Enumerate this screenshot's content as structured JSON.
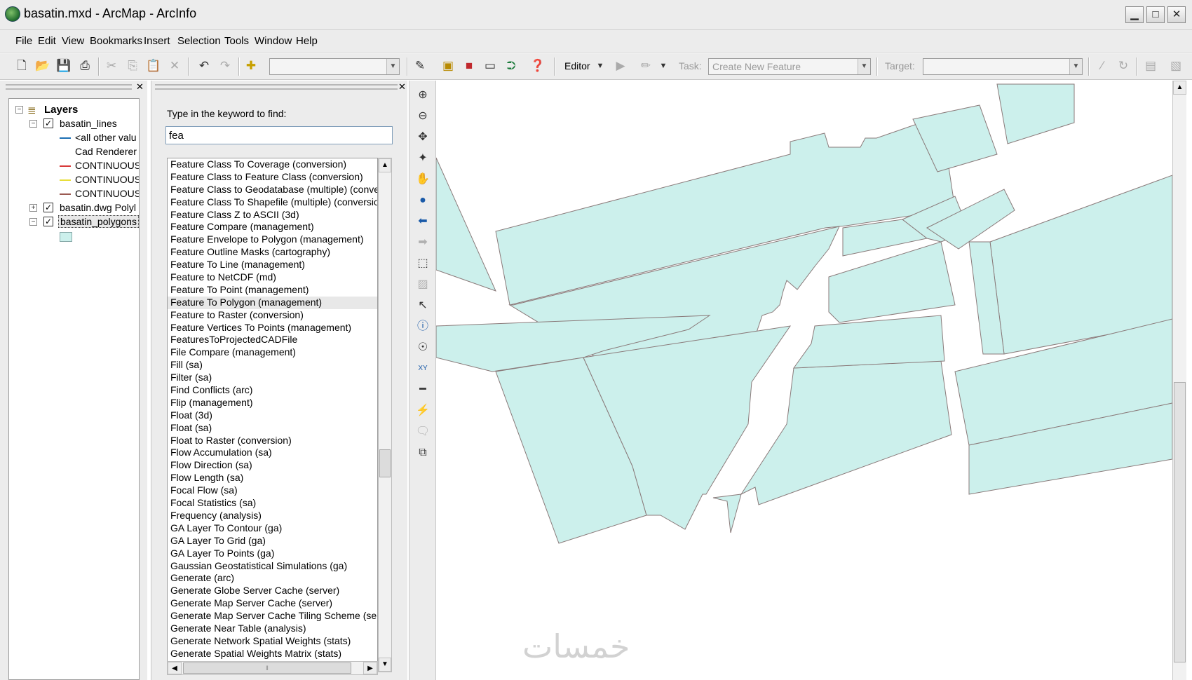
{
  "window": {
    "title": "basatin.mxd - ArcMap - ArcInfo",
    "app_icon": "arcmap-globe-icon",
    "controls": [
      "minimize",
      "maximize",
      "close"
    ]
  },
  "menu": [
    "File",
    "Edit",
    "View",
    "Bookmarks",
    "Insert",
    "Selection",
    "Tools",
    "Window",
    "Help"
  ],
  "toolbar": {
    "editor_label": "Editor",
    "task_label": "Task:",
    "task_value": "Create New Feature",
    "target_label": "Target:",
    "target_value": ""
  },
  "toc": {
    "root": "Layers",
    "layers": [
      {
        "name": "basatin_lines",
        "expanded": true,
        "checked": true
      },
      {
        "name": "<all other valu",
        "legend": "line",
        "color": "#1c6fb4"
      },
      {
        "name": "Cad Renderer",
        "legend": "none"
      },
      {
        "name": "CONTINUOUS",
        "legend": "line",
        "color": "#d83a3a"
      },
      {
        "name": "CONTINUOUS",
        "legend": "line",
        "color": "#e8de3a"
      },
      {
        "name": "CONTINUOUS",
        "legend": "line",
        "color": "#9b5a52"
      },
      {
        "name": "basatin.dwg Polyl",
        "expanded": false,
        "checked": true
      },
      {
        "name": "basatin_polygons",
        "expanded": true,
        "checked": true,
        "selected": true
      },
      {
        "name": "",
        "legend": "patch",
        "color": "#ccf0ec"
      }
    ]
  },
  "search": {
    "label": "Type in the keyword to find:",
    "query": "fea",
    "selected_index": 11,
    "results": [
      "Feature Class To Coverage (conversion)",
      "Feature Class to Feature Class (conversion)",
      "Feature Class to Geodatabase (multiple) (convers",
      "Feature Class To Shapefile (multiple) (conversion",
      "Feature Class Z to ASCII (3d)",
      "Feature Compare (management)",
      "Feature Envelope to Polygon (management)",
      "Feature Outline Masks (cartography)",
      "Feature To Line (management)",
      "Feature to NetCDF (md)",
      "Feature To Point (management)",
      "Feature To Polygon (management)",
      "Feature to Raster (conversion)",
      "Feature Vertices To Points (management)",
      "FeaturesToProjectedCADFile",
      "File Compare (management)",
      "Fill (sa)",
      "Filter (sa)",
      "Find Conflicts (arc)",
      "Flip (management)",
      "Float (3d)",
      "Float (sa)",
      "Float to Raster (conversion)",
      "Flow Accumulation (sa)",
      "Flow Direction (sa)",
      "Flow Length (sa)",
      "Focal Flow (sa)",
      "Focal Statistics (sa)",
      "Frequency (analysis)",
      "GA Layer To Contour (ga)",
      "GA Layer To Grid (ga)",
      "GA Layer To Points (ga)",
      "Gaussian Geostatistical Simulations (ga)",
      "Generate (arc)",
      "Generate Globe Server Cache (server)",
      "Generate Map Server Cache (server)",
      "Generate Map Server Cache Tiling Scheme (serv",
      "Generate Near Table (analysis)",
      "Generate Network Spatial Weights (stats)",
      "Generate Spatial Weights Matrix (stats)"
    ]
  },
  "map": {
    "polygon_fill": "#ccf0ec",
    "polygon_stroke": "#8a7a7a",
    "watermark": "خمسات"
  }
}
